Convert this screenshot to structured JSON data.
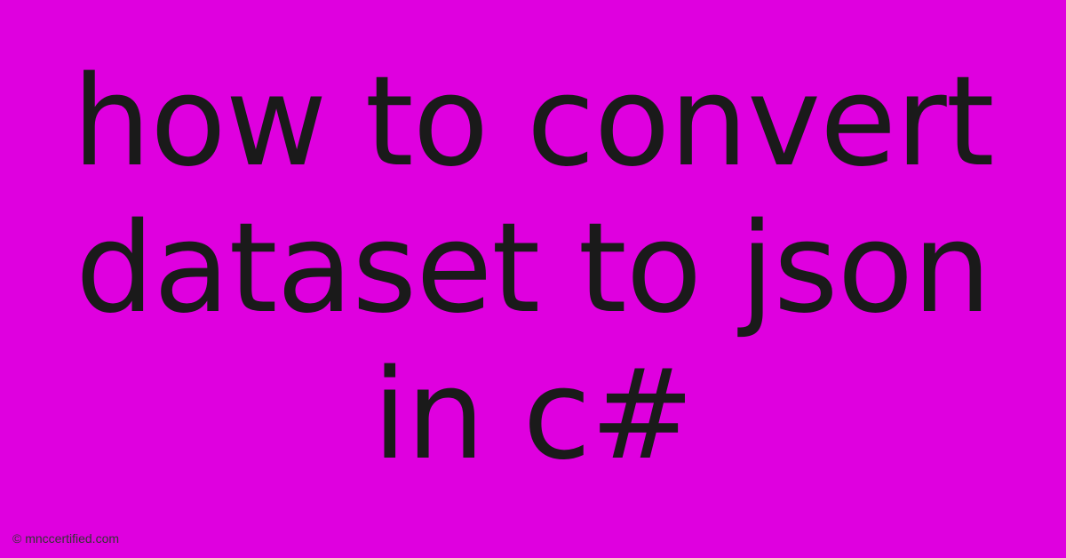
{
  "main": {
    "title_line1": "how to convert",
    "title_line2": "dataset to json",
    "title_line3": "in c#"
  },
  "footer": {
    "attribution": "© mnccertified.com"
  },
  "colors": {
    "background": "#df00df",
    "text": "#1a1a1a"
  }
}
